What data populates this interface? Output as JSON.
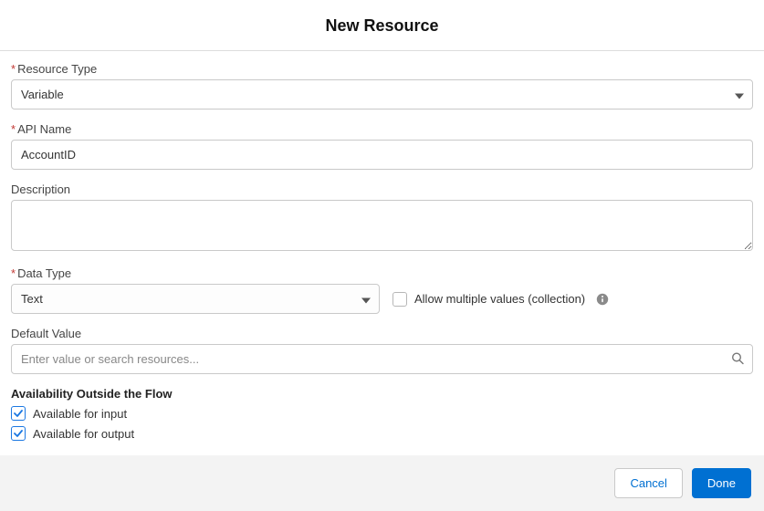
{
  "dialog": {
    "title": "New Resource"
  },
  "fields": {
    "resourceType": {
      "label": "Resource Type",
      "value": "Variable"
    },
    "apiName": {
      "label": "API Name",
      "value": "AccountID"
    },
    "description": {
      "label": "Description",
      "value": ""
    },
    "dataType": {
      "label": "Data Type",
      "value": "Text"
    },
    "allowMultiple": {
      "label": "Allow multiple values (collection)"
    },
    "defaultValue": {
      "label": "Default Value",
      "placeholder": "Enter value or search resources..."
    }
  },
  "availability": {
    "heading": "Availability Outside the Flow",
    "input": {
      "label": "Available for input"
    },
    "output": {
      "label": "Available for output"
    }
  },
  "footer": {
    "cancel": "Cancel",
    "done": "Done"
  }
}
